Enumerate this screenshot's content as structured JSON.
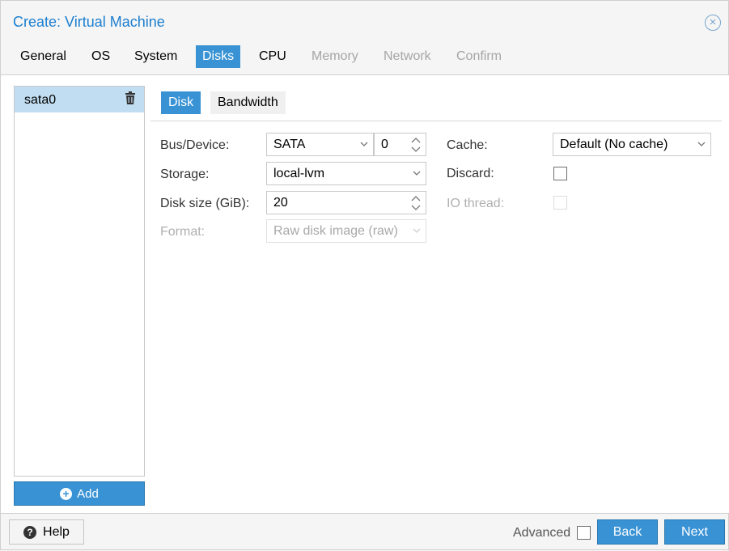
{
  "window": {
    "title": "Create: Virtual Machine",
    "close_icon": "close-icon"
  },
  "tabs": [
    {
      "label": "General",
      "state": "normal"
    },
    {
      "label": "OS",
      "state": "normal"
    },
    {
      "label": "System",
      "state": "normal"
    },
    {
      "label": "Disks",
      "state": "active"
    },
    {
      "label": "CPU",
      "state": "normal"
    },
    {
      "label": "Memory",
      "state": "disabled"
    },
    {
      "label": "Network",
      "state": "disabled"
    },
    {
      "label": "Confirm",
      "state": "disabled"
    }
  ],
  "disk_list": {
    "items": [
      {
        "label": "sata0",
        "selected": true
      }
    ],
    "remove_icon": "trash-icon",
    "add_label": "Add",
    "add_icon": "plus-circle-icon"
  },
  "subtabs": [
    {
      "label": "Disk",
      "active": true
    },
    {
      "label": "Bandwidth",
      "active": false
    }
  ],
  "form": {
    "bus_device": {
      "label": "Bus/Device:",
      "bus_value": "SATA",
      "device_value": "0"
    },
    "storage": {
      "label": "Storage:",
      "value": "local-lvm"
    },
    "disk_size": {
      "label": "Disk size (GiB):",
      "value": "20"
    },
    "format": {
      "label": "Format:",
      "value": "Raw disk image (raw)",
      "disabled": true
    },
    "cache": {
      "label": "Cache:",
      "value": "Default (No cache)"
    },
    "discard": {
      "label": "Discard:",
      "checked": false
    },
    "io_thread": {
      "label": "IO thread:",
      "checked": false,
      "disabled": true
    }
  },
  "footer": {
    "help_label": "Help",
    "help_icon": "question-circle-icon",
    "advanced_label": "Advanced",
    "advanced_checked": false,
    "back_label": "Back",
    "next_label": "Next"
  },
  "colors": {
    "accent": "#3892d4",
    "title": "#1c7fd0",
    "selected_row": "#c1ddf1",
    "disabled_text": "#a5a5a5"
  }
}
